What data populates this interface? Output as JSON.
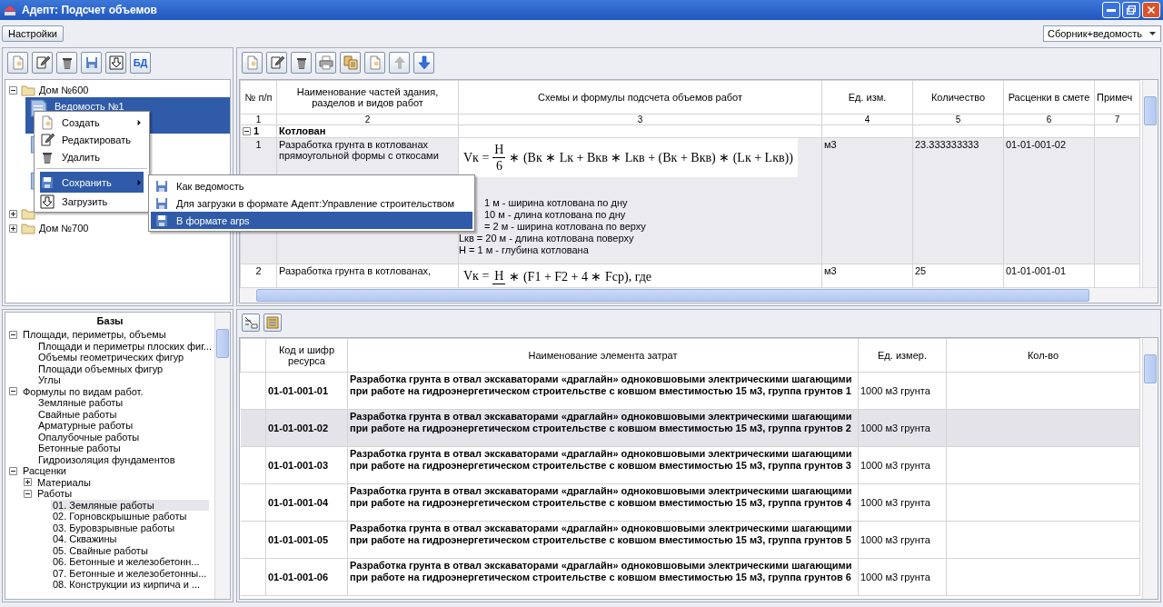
{
  "window": {
    "title": "Адепт: Подсчет объемов"
  },
  "menu_bar": {
    "settings_button": "Настройки",
    "view_select": "Сборник+ведомость"
  },
  "left_toolbar": {
    "db_button": "БД"
  },
  "houses": [
    {
      "label": "Дом №600",
      "expanded": true,
      "selected": false,
      "children": [
        {
          "label": "Ведомость №1",
          "selected": true
        },
        {
          "selected": false
        },
        {
          "selected": false
        }
      ]
    },
    {
      "expanded": false,
      "selected": false
    },
    {
      "label": "Дом №700",
      "expanded": false,
      "selected": false
    }
  ],
  "context_menu": {
    "items": [
      {
        "label": "Создать",
        "has_submenu": true,
        "selected": false,
        "separator_before": false
      },
      {
        "label": "Редактировать",
        "has_submenu": false,
        "selected": false,
        "separator_before": false
      },
      {
        "label": "Удалить",
        "has_submenu": false,
        "selected": false,
        "separator_before": false
      },
      {
        "label": "Сохранить",
        "has_submenu": true,
        "selected": true,
        "separator_before": true
      },
      {
        "label": "Загрузить",
        "has_submenu": false,
        "selected": false,
        "separator_before": false
      }
    ],
    "submenu": [
      {
        "label": "Как ведомость",
        "selected": false
      },
      {
        "label": "Для загрузки в формате Адепт:Управление строительством",
        "selected": false
      },
      {
        "label": "В формате arps",
        "selected": true
      }
    ]
  },
  "volumes": {
    "columns": [
      "№ п/п",
      "Наименование частей здания, разделов и видов работ",
      "Схемы и формулы подсчета объемов работ",
      "Ед. изм.",
      "Количество",
      "Расценки в смете",
      "Примеч"
    ],
    "numbers": [
      "1",
      "2",
      "3",
      "4",
      "5",
      "6",
      "7"
    ],
    "groups": [
      {
        "number": "1",
        "title": "Котлован",
        "expanded": true,
        "rows": [
          {
            "number": "1",
            "name": "Разработка грунта в котлованах прямоугольной формы с откосами",
            "formula": {
              "lhs": "Vк =",
              "numerator": "H",
              "denominator": "6",
              "rest": "∗ (Bк ∗ Lк + Bкв ∗ Lкв + (Bк + Bкв) ∗ (Lк + Lкв))"
            },
            "notes": [
              "1 м - ширина котлована по дну",
              "10 м - длина котлована по дну",
              "= 2 м - ширина котлована по верху",
              "Lкв = 20 м - длина котлована поверху",
              "H = 1 м - глубина котлована"
            ],
            "unit": "м3",
            "quantity": "23.333333333",
            "rate": "01-01-001-02",
            "selected": true
          },
          {
            "number": "2",
            "name": "Разработка грунта в котлованах,",
            "formula": {
              "lhs": "Vк =",
              "numerator": "H",
              "rest": "∗ (F1 + F2 + 4 ∗ Fср), где"
            },
            "unit": "м3",
            "quantity": "25",
            "rate": "01-01-001-01",
            "selected": false
          }
        ]
      }
    ]
  },
  "bases": {
    "title": "Базы",
    "tree": [
      {
        "label": "Площади, периметры, объемы",
        "expanded": true,
        "selected": false,
        "children": [
          {
            "label": "Площади и периметры плоских фиг...",
            "selected": false
          },
          {
            "label": "Объемы геометрических фигур",
            "selected": false
          },
          {
            "label": "Площади объемных фигур",
            "selected": false
          },
          {
            "label": "Углы",
            "selected": false
          }
        ]
      },
      {
        "label": "Формулы по видам работ.",
        "expanded": true,
        "selected": false,
        "children": [
          {
            "label": "Земляные работы",
            "selected": false
          },
          {
            "label": "Свайные работы",
            "selected": false
          },
          {
            "label": "Арматурные работы",
            "selected": false
          },
          {
            "label": "Опалубочные  работы",
            "selected": false
          },
          {
            "label": "Бетонные работы",
            "selected": false
          },
          {
            "label": "Гидроизоляция фундаментов",
            "selected": false
          }
        ]
      },
      {
        "label": "Расценки",
        "expanded": true,
        "selected": false,
        "children": [
          {
            "label": "Материалы",
            "expanded": false,
            "selected": false
          },
          {
            "label": "Работы",
            "expanded": true,
            "selected": false,
            "children": [
              {
                "label": "01. Земляные работы",
                "selected": true
              },
              {
                "label": "02. Горновскрышные работы",
                "selected": false
              },
              {
                "label": "03. Буровзрывные работы",
                "selected": false
              },
              {
                "label": "04. Скважины",
                "selected": false
              },
              {
                "label": "05. Свайные работы",
                "selected": false
              },
              {
                "label": "06. Бетонные и железобетонн...",
                "selected": false
              },
              {
                "label": "07. Бетонные и железобетонны...",
                "selected": false
              },
              {
                "label": "08. Конструкции из кирпича и ...",
                "selected": false
              }
            ]
          }
        ]
      }
    ]
  },
  "resources": {
    "columns": [
      "Код и шифр ресурса",
      "Наименование элемента затрат",
      "Ед. измер.",
      "Кол-во"
    ],
    "rows": [
      {
        "code": "01-01-001-01",
        "name": "Разработка грунта в отвал экскаваторами «драглайн» одноковшовыми электрическими шагающими при работе на гидроэнергетическом строительстве с ковшом вместимостью 15 м3, группа грунтов 1",
        "unit": "1000 м3 грунта",
        "selected": false
      },
      {
        "code": "01-01-001-02",
        "name": "Разработка грунта в отвал экскаваторами «драглайн» одноковшовыми электрическими шагающими при работе на гидроэнергетическом строительстве с ковшом вместимостью 15 м3, группа грунтов 2",
        "unit": "1000 м3 грунта",
        "selected": true
      },
      {
        "code": "01-01-001-03",
        "name": "Разработка грунта в отвал экскаваторами «драглайн» одноковшовыми электрическими шагающими при работе на гидроэнергетическом строительстве с ковшом вместимостью 15 м3, группа грунтов 3",
        "unit": "1000 м3 грунта",
        "selected": false
      },
      {
        "code": "01-01-001-04",
        "name": "Разработка грунта в отвал экскаваторами «драглайн» одноковшовыми электрическими шагающими при работе на гидроэнергетическом строительстве с ковшом вместимостью 15 м3, группа грунтов 4",
        "unit": "1000 м3 грунта",
        "selected": false
      },
      {
        "code": "01-01-001-05",
        "name": "Разработка грунта в отвал экскаваторами «драглайн» одноковшовыми электрическими шагающими при работе на гидроэнергетическом строительстве с ковшом вместимостью 15 м3, группа грунтов 5",
        "unit": "1000 м3 грунта",
        "selected": false
      },
      {
        "code": "01-01-001-06",
        "name": "Разработка грунта в отвал экскаваторами «драглайн» одноковшовыми электрическими шагающими при работе на гидроэнергетическом строительстве с ковшом вместимостью 15 м3, группа грунтов 6",
        "unit": "1000 м3 грунта",
        "selected": false
      }
    ]
  }
}
